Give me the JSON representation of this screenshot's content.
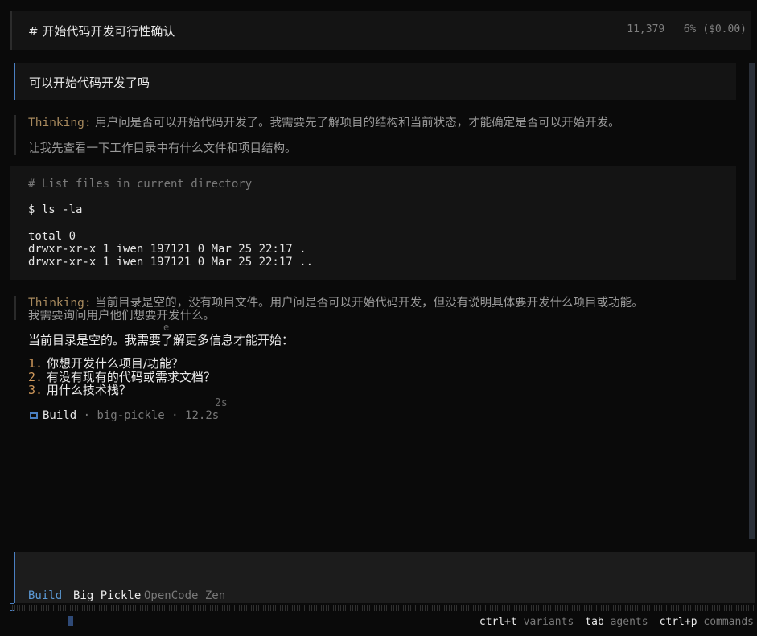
{
  "header": {
    "title": "# 开始代码开发可行性确认",
    "tokens": "11,379",
    "usage": "6% ($0.00)"
  },
  "conversation": {
    "user_message": "可以开始代码开发了吗",
    "thinking_label": "Thinking:",
    "thinking1_line1": " 用户问是否可以开始代码开发了。我需要先了解项目的结构和当前状态，才能确定是否可以开始开发。",
    "thinking1_line2": "让我先查看一下工作目录中有什么文件和项目结构。",
    "tool": {
      "comment": "# List files in current directory",
      "command": "$ ls -la",
      "output": "total 0\ndrwxr-xr-x 1 iwen 197121 0 Mar 25 22:17 .\ndrwxr-xr-x 1 iwen 197121 0 Mar 25 22:17 .."
    },
    "thinking2_line1": " 当前目录是空的，没有项目文件。用户问是否可以开始代码开发，但没有说明具体要开发什么项目或功能。",
    "thinking2_line2": "我需要询问用户他们想要开发什么。",
    "answer": "当前目录是空的。我需要了解更多信息才能开始：",
    "questions": [
      {
        "num": "1.",
        "text": " 你想开发什么项目/功能？"
      },
      {
        "num": "2.",
        "text": " 有没有现有的代码或需求文档？"
      },
      {
        "num": "3.",
        "text": " 用什么技术栈？"
      }
    ],
    "ghost_e": "e",
    "ghost_time": "2s",
    "build": {
      "agent": "Build",
      "sep": " · ",
      "model": "big-pickle",
      "duration": "12.2s"
    }
  },
  "input": {
    "agent": "Build",
    "model": "Big Pickle",
    "provider": "OpenCode Zen"
  },
  "footer": {
    "k1": "ctrl+t",
    "d1": " variants",
    "k2": "tab",
    "d2": " agents",
    "k3": "ctrl+p",
    "d3": " commands"
  },
  "colors": {
    "accent": "#4a7fc1",
    "thinking": "#a88a5e",
    "list_number": "#d29a5c",
    "background": "#0a0a0a"
  }
}
